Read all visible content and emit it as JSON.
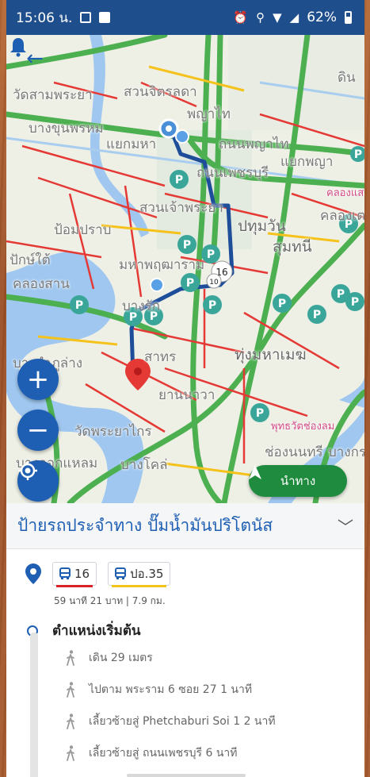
{
  "status_bar": {
    "time": "15:06 น.",
    "battery": "62%",
    "icons": [
      "notification-icon",
      "photo-icon",
      "alarm-icon",
      "location-icon",
      "wifi-icon",
      "signal-icon",
      "battery-icon"
    ]
  },
  "map": {
    "labels": [
      "วัดสามพระยา",
      "สวนจิตรลดา",
      "พญาไท",
      "บางขุนพรหม",
      "แยกมหา",
      "ถนนพญาไท",
      "ถนนเพชรบุรี",
      "คลองแสน",
      "คลองเตย",
      "ป้อมปราบ",
      "สวนเจ้าพระยา",
      "ปทุมวัน",
      "สุมทนี",
      "มหาพฤฒาราม",
      "คลองสาน",
      "บางรัก",
      "สาทร",
      "ทุ่งมหาเมฆ",
      "ยานนาวา",
      "วัดพระยาไกร",
      "บางกอกแหลม",
      "บางโคล่",
      "พุทธวัตช่องลม",
      "ช่องนนทรี",
      "บางกระเจ้า",
      "บางลำภูล่าง",
      "ปักษ์ใต้",
      "ดิน",
      "แยกพญา"
    ],
    "pink_labels": [
      "คลอง",
      "คลองแสน"
    ],
    "bus_bubble": "16",
    "bus_bubble_2": "10",
    "parking_letter": "P"
  },
  "controls": {
    "back": "back-arrow-icon",
    "bell": "bell-icon",
    "zoom_in": "+",
    "zoom_out": "−",
    "locate": "locate-icon",
    "navigate_label": "นำทาง"
  },
  "sheet": {
    "title": "ป้ายรถประจำทาง ปั๊มน้ำมันปริโตนัส",
    "routes": [
      {
        "label": "16",
        "color": "#d8232a"
      },
      {
        "label": "ปอ.35",
        "color": "#f2c318"
      }
    ],
    "meta": "59 นาที 21 บาท | 7.9 กม.",
    "start": "ตำแหน่งเริ่มต้น",
    "steps": [
      "เดิน 29 เมตร",
      "ไปตาม พระราม 6 ซอย 27 1 นาที",
      "เลี้ยวซ้ายสู่ Phetchaburi Soi 1 2 นาที",
      "เลี้ยวซ้ายสู่ ถนนเพชรบุรี 6 นาที"
    ]
  },
  "colors": {
    "primary": "#1e5fb4",
    "status_bar": "#1e4e8c",
    "navigate_button": "#1f8b3e",
    "road_green": "#4caf50",
    "road_red": "#e53935",
    "road_yellow": "#f5c21b",
    "route_line": "#1e4e9a",
    "river": "#9fc7f0"
  }
}
